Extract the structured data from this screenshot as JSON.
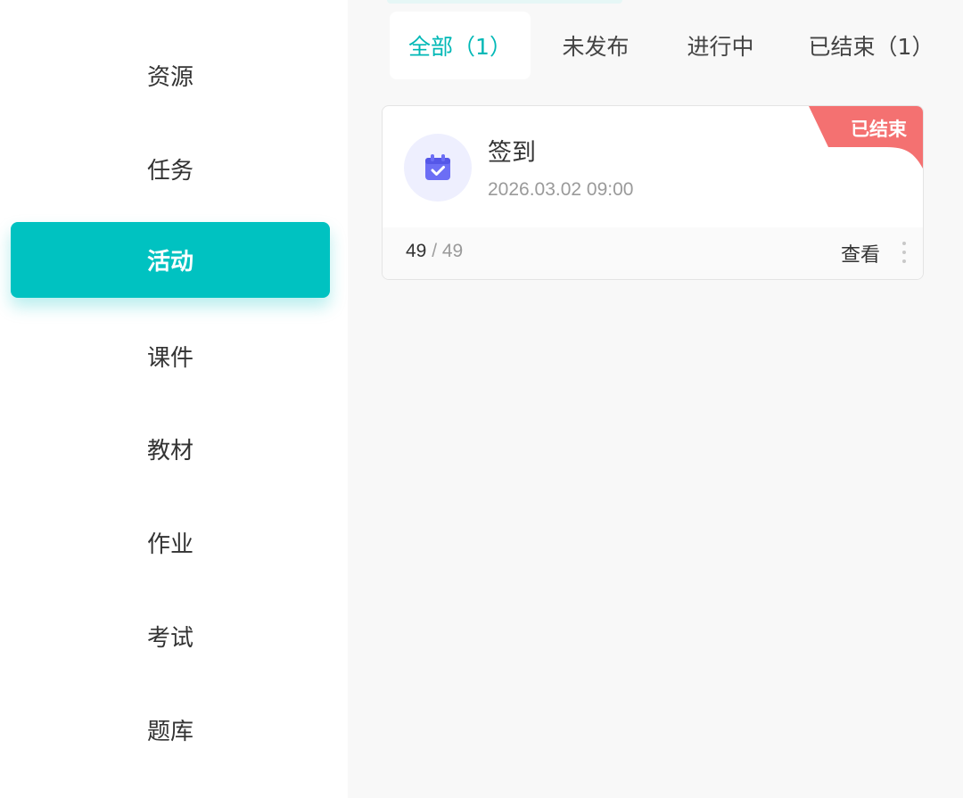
{
  "sidebar": {
    "items": [
      {
        "label": "资源"
      },
      {
        "label": "任务"
      },
      {
        "label": "活动",
        "active": true
      },
      {
        "label": "课件"
      },
      {
        "label": "教材"
      },
      {
        "label": "作业"
      },
      {
        "label": "考试"
      },
      {
        "label": "题库"
      }
    ]
  },
  "tabs": [
    {
      "label": "全部（1）",
      "active": true
    },
    {
      "label": "未发布"
    },
    {
      "label": "进行中"
    },
    {
      "label": "已结束（1）"
    }
  ],
  "activity": {
    "icon": "calendar-check-icon",
    "title": "签到",
    "time": "2026.03.02 09:00",
    "status": "已结束",
    "count_done": "49",
    "count_sep": " / ",
    "count_total": "49",
    "view_label": "查看",
    "more_icon": "more-vertical-icon"
  },
  "colors": {
    "accent": "#00c2c1",
    "status_ended": "#f47171",
    "icon_bg": "#eeeffe",
    "icon_fg": "#6c6ef5"
  }
}
